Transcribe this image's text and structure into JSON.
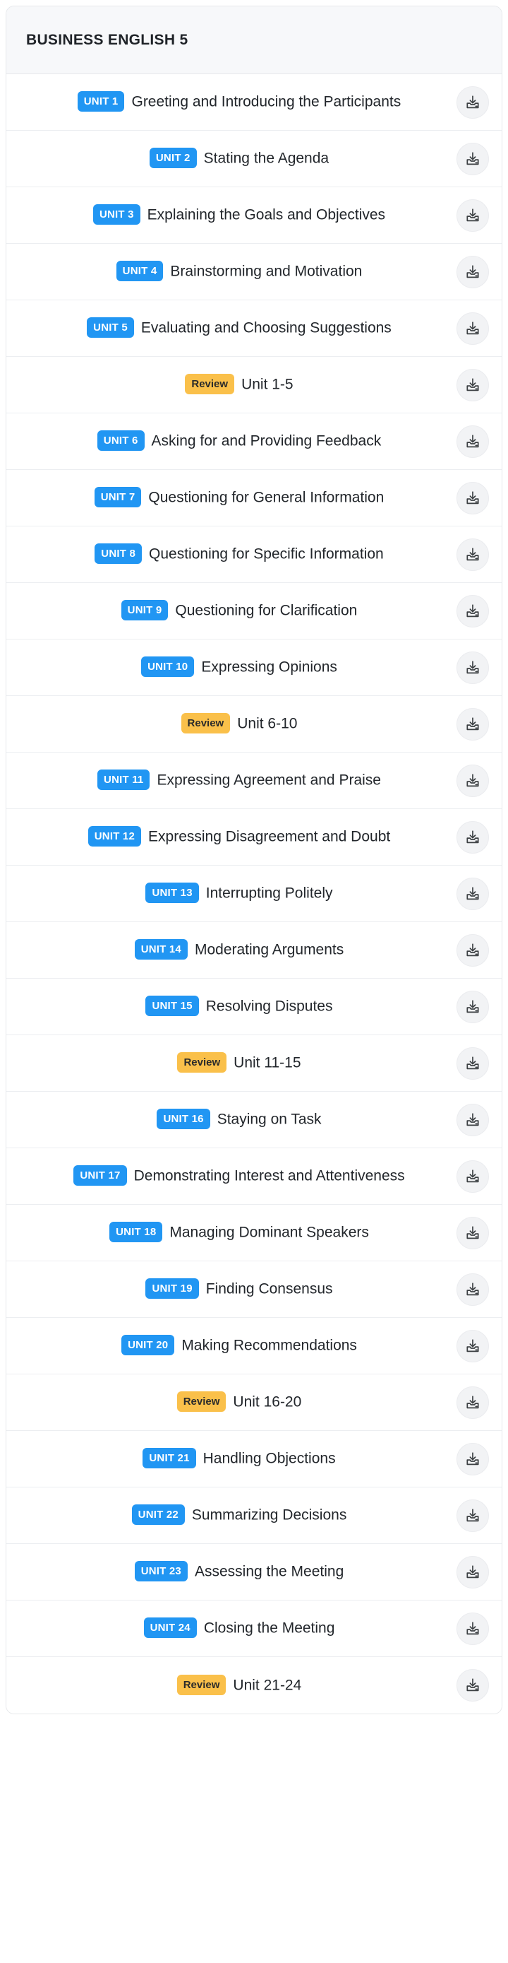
{
  "header": {
    "title": "BUSINESS ENGLISH 5"
  },
  "icons": {
    "download": "download-icon"
  },
  "colors": {
    "unit_badge_bg": "#2196f3",
    "unit_badge_text": "#ffffff",
    "review_badge_bg": "#fac04a",
    "review_badge_text": "#2b2b2b",
    "header_bg": "#f7f8fa",
    "row_border": "#eceef1",
    "card_border": "#e6e8eb",
    "text": "#1f2328",
    "icon_circle_bg": "#f2f3f5"
  },
  "rows": [
    {
      "badge": "UNIT 1",
      "type": "unit",
      "title": "Greeting and Introducing the Participants"
    },
    {
      "badge": "UNIT 2",
      "type": "unit",
      "title": "Stating the Agenda"
    },
    {
      "badge": "UNIT 3",
      "type": "unit",
      "title": "Explaining the Goals and Objectives"
    },
    {
      "badge": "UNIT 4",
      "type": "unit",
      "title": "Brainstorming and Motivation"
    },
    {
      "badge": "UNIT 5",
      "type": "unit",
      "title": "Evaluating and Choosing Suggestions"
    },
    {
      "badge": "Review",
      "type": "review",
      "title": "Unit 1-5"
    },
    {
      "badge": "UNIT 6",
      "type": "unit",
      "title": "Asking for and Providing Feedback"
    },
    {
      "badge": "UNIT 7",
      "type": "unit",
      "title": "Questioning for General Information"
    },
    {
      "badge": "UNIT 8",
      "type": "unit",
      "title": "Questioning for Specific Information"
    },
    {
      "badge": "UNIT 9",
      "type": "unit",
      "title": "Questioning for Clarification"
    },
    {
      "badge": "UNIT 10",
      "type": "unit",
      "title": "Expressing Opinions"
    },
    {
      "badge": "Review",
      "type": "review",
      "title": "Unit 6-10"
    },
    {
      "badge": "UNIT 11",
      "type": "unit",
      "title": "Expressing Agreement and Praise"
    },
    {
      "badge": "UNIT 12",
      "type": "unit",
      "title": "Expressing Disagreement and Doubt"
    },
    {
      "badge": "UNIT 13",
      "type": "unit",
      "title": "Interrupting Politely"
    },
    {
      "badge": "UNIT 14",
      "type": "unit",
      "title": "Moderating Arguments"
    },
    {
      "badge": "UNIT 15",
      "type": "unit",
      "title": "Resolving Disputes"
    },
    {
      "badge": "Review",
      "type": "review",
      "title": "Unit 11-15"
    },
    {
      "badge": "UNIT 16",
      "type": "unit",
      "title": "Staying on Task"
    },
    {
      "badge": "UNIT 17",
      "type": "unit",
      "title": "Demonstrating Interest and Attentiveness"
    },
    {
      "badge": "UNIT 18",
      "type": "unit",
      "title": "Managing Dominant Speakers"
    },
    {
      "badge": "UNIT 19",
      "type": "unit",
      "title": "Finding Consensus"
    },
    {
      "badge": "UNIT 20",
      "type": "unit",
      "title": "Making Recommendations"
    },
    {
      "badge": "Review",
      "type": "review",
      "title": "Unit 16-20"
    },
    {
      "badge": "UNIT 21",
      "type": "unit",
      "title": "Handling Objections"
    },
    {
      "badge": "UNIT 22",
      "type": "unit",
      "title": "Summarizing Decisions"
    },
    {
      "badge": "UNIT 23",
      "type": "unit",
      "title": "Assessing the Meeting"
    },
    {
      "badge": "UNIT 24",
      "type": "unit",
      "title": "Closing the Meeting"
    },
    {
      "badge": "Review",
      "type": "review",
      "title": "Unit 21-24"
    }
  ]
}
